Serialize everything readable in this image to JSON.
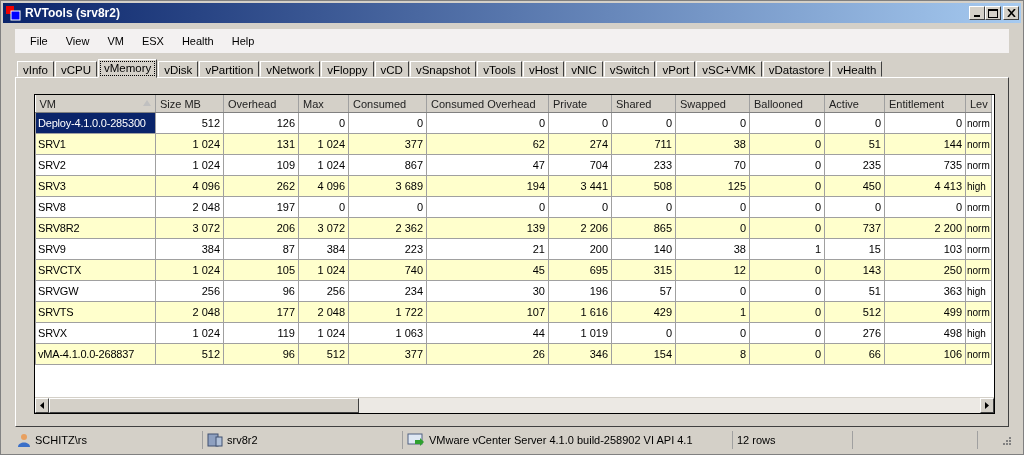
{
  "window": {
    "title": "RVTools (srv8r2)"
  },
  "menu": [
    "File",
    "View",
    "VM",
    "ESX",
    "Health",
    "Help"
  ],
  "tabs": [
    {
      "label": "vInfo",
      "selected": false
    },
    {
      "label": "vCPU",
      "selected": false
    },
    {
      "label": "vMemory",
      "selected": true
    },
    {
      "label": "vDisk",
      "selected": false
    },
    {
      "label": "vPartition",
      "selected": false
    },
    {
      "label": "vNetwork",
      "selected": false
    },
    {
      "label": "vFloppy",
      "selected": false
    },
    {
      "label": "vCD",
      "selected": false
    },
    {
      "label": "vSnapshot",
      "selected": false
    },
    {
      "label": "vTools",
      "selected": false
    },
    {
      "label": "vHost",
      "selected": false
    },
    {
      "label": "vNIC",
      "selected": false
    },
    {
      "label": "vSwitch",
      "selected": false
    },
    {
      "label": "vPort",
      "selected": false
    },
    {
      "label": "vSC+VMK",
      "selected": false
    },
    {
      "label": "vDatastore",
      "selected": false
    },
    {
      "label": "vHealth",
      "selected": false
    }
  ],
  "table": {
    "columns": [
      {
        "label": "VM",
        "sorted": true
      },
      {
        "label": "Size MB",
        "sorted": false
      },
      {
        "label": "Overhead",
        "sorted": false
      },
      {
        "label": "Max",
        "sorted": false
      },
      {
        "label": "Consumed",
        "sorted": false
      },
      {
        "label": "Consumed Overhead",
        "sorted": false
      },
      {
        "label": "Private",
        "sorted": false
      },
      {
        "label": "Shared",
        "sorted": false
      },
      {
        "label": "Swapped",
        "sorted": false
      },
      {
        "label": "Ballooned",
        "sorted": false
      },
      {
        "label": "Active",
        "sorted": false
      },
      {
        "label": "Entitlement",
        "sorted": false
      },
      {
        "label": "Lev",
        "sorted": false
      }
    ],
    "rows": [
      {
        "selected": true,
        "cells": [
          "Deploy-4.1.0.0-285300",
          "512",
          "126",
          "0",
          "0",
          "0",
          "0",
          "0",
          "0",
          "0",
          "0",
          "0",
          "norm"
        ]
      },
      {
        "selected": false,
        "cells": [
          "SRV1",
          "1 024",
          "131",
          "1 024",
          "377",
          "62",
          "274",
          "711",
          "38",
          "0",
          "51",
          "144",
          "norm"
        ]
      },
      {
        "selected": false,
        "cells": [
          "SRV2",
          "1 024",
          "109",
          "1 024",
          "867",
          "47",
          "704",
          "233",
          "70",
          "0",
          "235",
          "735",
          "norm"
        ]
      },
      {
        "selected": false,
        "cells": [
          "SRV3",
          "4 096",
          "262",
          "4 096",
          "3 689",
          "194",
          "3 441",
          "508",
          "125",
          "0",
          "450",
          "4 413",
          "high"
        ]
      },
      {
        "selected": false,
        "cells": [
          "SRV8",
          "2 048",
          "197",
          "0",
          "0",
          "0",
          "0",
          "0",
          "0",
          "0",
          "0",
          "0",
          "norm"
        ]
      },
      {
        "selected": false,
        "cells": [
          "SRV8R2",
          "3 072",
          "206",
          "3 072",
          "2 362",
          "139",
          "2 206",
          "865",
          "0",
          "0",
          "737",
          "2 200",
          "norm"
        ]
      },
      {
        "selected": false,
        "cells": [
          "SRV9",
          "384",
          "87",
          "384",
          "223",
          "21",
          "200",
          "140",
          "38",
          "1",
          "15",
          "103",
          "norm"
        ]
      },
      {
        "selected": false,
        "cells": [
          "SRVCTX",
          "1 024",
          "105",
          "1 024",
          "740",
          "45",
          "695",
          "315",
          "12",
          "0",
          "143",
          "250",
          "norm"
        ]
      },
      {
        "selected": false,
        "cells": [
          "SRVGW",
          "256",
          "96",
          "256",
          "234",
          "30",
          "196",
          "57",
          "0",
          "0",
          "51",
          "363",
          "high"
        ]
      },
      {
        "selected": false,
        "cells": [
          "SRVTS",
          "2 048",
          "177",
          "2 048",
          "1 722",
          "107",
          "1 616",
          "429",
          "1",
          "0",
          "512",
          "499",
          "norm"
        ]
      },
      {
        "selected": false,
        "cells": [
          "SRVX",
          "1 024",
          "119",
          "1 024",
          "1 063",
          "44",
          "1 019",
          "0",
          "0",
          "0",
          "276",
          "498",
          "high"
        ]
      },
      {
        "selected": false,
        "cells": [
          "vMA-4.1.0.0-268837",
          "512",
          "96",
          "512",
          "377",
          "26",
          "346",
          "154",
          "8",
          "0",
          "66",
          "106",
          "norm"
        ]
      }
    ]
  },
  "status_bar": [
    {
      "kind": "user",
      "text": "SCHITZ\\rs"
    },
    {
      "kind": "server",
      "text": "srv8r2"
    },
    {
      "kind": "vcenter",
      "text": "VMware vCenter Server 4.1.0 build-258902  VI API 4.1"
    },
    {
      "kind": "plain",
      "text": "12 rows"
    }
  ]
}
